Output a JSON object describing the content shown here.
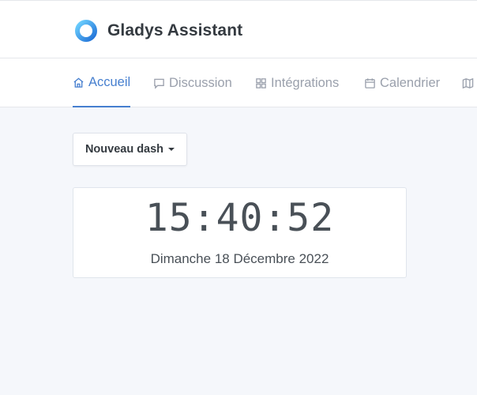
{
  "brand": {
    "name": "Gladys Assistant",
    "logo_icon": "gladys-ring-logo-icon"
  },
  "nav": {
    "items": [
      {
        "label": "Accueil",
        "icon": "home-icon",
        "active": true
      },
      {
        "label": "Discussion",
        "icon": "chat-icon",
        "active": false
      },
      {
        "label": "Intégrations",
        "icon": "grid-icon",
        "active": false
      },
      {
        "label": "Calendrier",
        "icon": "calendar-icon",
        "active": false
      },
      {
        "label": "",
        "icon": "map-icon",
        "active": false
      }
    ]
  },
  "dashboard": {
    "selector_label": "Nouveau dash"
  },
  "clock": {
    "time": "15:40:52",
    "date": "Dimanche 18 Décembre 2022"
  },
  "colors": {
    "accent": "#467fcf",
    "background": "#f5f7fb",
    "nav_inactive": "#9aa0ac"
  }
}
